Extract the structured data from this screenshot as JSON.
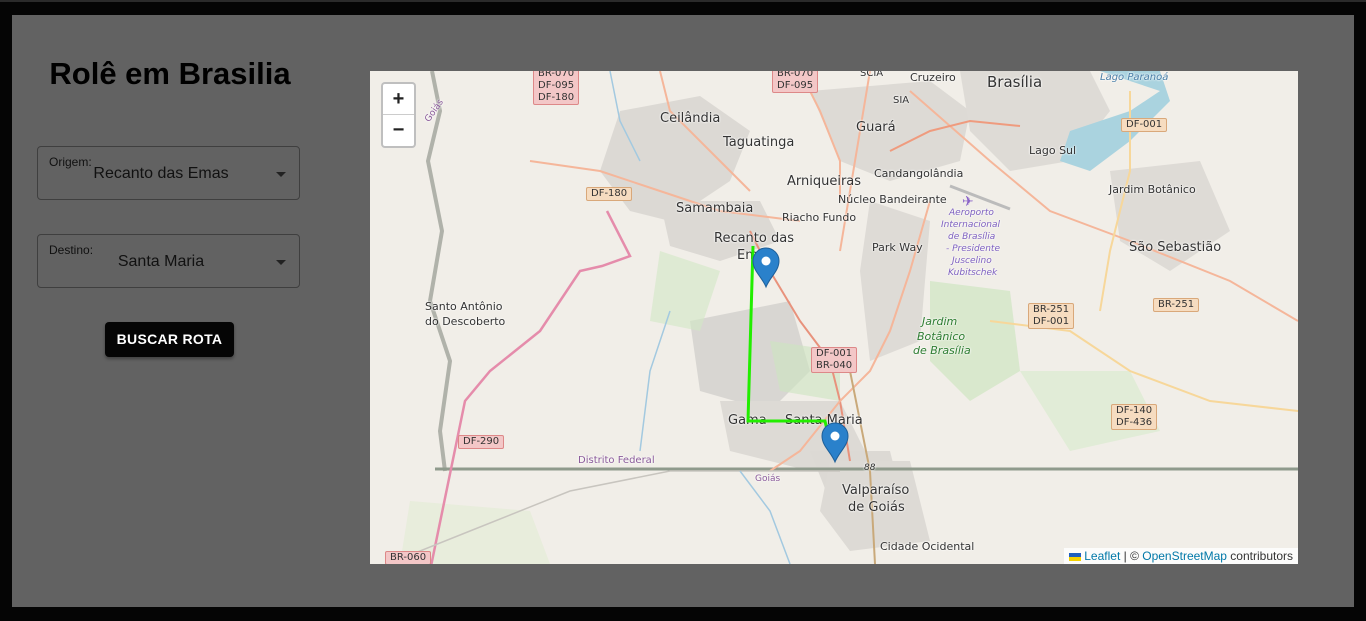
{
  "page": {
    "title": "Rolê em Brasilia"
  },
  "form": {
    "origin": {
      "label": "Origem:",
      "value": "Recanto das Emas"
    },
    "destination": {
      "label": "Destino:",
      "value": "Santa Maria"
    },
    "search_button": "BUSCAR ROTA"
  },
  "map": {
    "zoom_in": "+",
    "zoom_out": "−",
    "route_color": "#22ee00",
    "marker_color": "#2a81cb",
    "places": {
      "brasilia": "Brasília",
      "cruzeiro": "Cruzeiro",
      "scia": "SCIA",
      "sia": "SIA",
      "ceilandia": "Ceilândia",
      "guara": "Guará",
      "taguatinga": "Taguatinga",
      "lago_sul": "Lago Sul",
      "candangolandia": "Candangolândia",
      "arniqueiras": "Arniqueiras",
      "nucleo_bandeirante": "Núcleo Bandeirante",
      "samambaia": "Samambaia",
      "riacho_fundo": "Riacho Fundo",
      "jardim_botanico": "Jardim Botânico",
      "recanto_1": "Recanto das",
      "recanto_2": "Emas",
      "park_way": "Park Way",
      "sao_sebastiao": "São Sebastião",
      "santo_antonio_1": "Santo Antônio",
      "santo_antonio_2": "do Descoberto",
      "gama": "Gama",
      "santa_maria": "Santa Maria",
      "valparaiso_1": "Valparaíso",
      "valparaiso_2": "de Goiás",
      "cidade_ocidental": "Cidade Ocidental",
      "distrito_federal": "Distrito Federal",
      "goias_1": "Goiás",
      "goias_2": "Goiás",
      "lago_paranoa": "Lago Paranoá",
      "aeroporto_1": "Aeroporto",
      "aeroporto_2": "Internacional",
      "aeroporto_3": "de Brasília",
      "aeroporto_4": "- Presidente",
      "aeroporto_5": "Juscelino",
      "aeroporto_6": "Kubitschek",
      "jardim_bot_1": "Jardim",
      "jardim_bot_2": "Botânico",
      "jardim_bot_3": "de Brasília",
      "road_88": "88"
    },
    "shields": {
      "br070_a": "BR-070",
      "df095_a": "DF-095",
      "df180_a": "DF-180",
      "br070_b": "BR-070",
      "df095_b": "DF-095",
      "df001_a": "DF-001",
      "df180_b": "DF-180",
      "br251_a": "BR-251",
      "df001_b": "DF-001",
      "br251_b": "BR-251",
      "df001_c": "DF-001",
      "br040": "BR-040",
      "df140": "DF-140",
      "df436": "DF-436",
      "df290": "DF-290",
      "br060": "BR-060"
    },
    "attribution": {
      "leaflet": "Leaflet",
      "sep": " | © ",
      "osm": "OpenStreetMap",
      "tail": " contributors"
    }
  }
}
